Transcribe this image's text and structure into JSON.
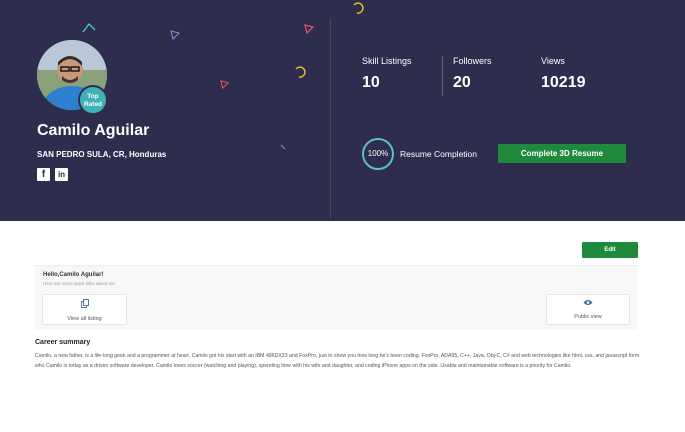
{
  "profile": {
    "name": "Camilo Aguilar",
    "location": "SAN PEDRO SULA, CR, Honduras",
    "badge": "Top Rated"
  },
  "stats": [
    {
      "label": "Skill Listings",
      "value": "10"
    },
    {
      "label": "Followers",
      "value": "20"
    },
    {
      "label": "Views",
      "value": "10219"
    }
  ],
  "resume": {
    "percent": "100%",
    "label": "Resume Completion",
    "button": "Complete 3D Resume"
  },
  "edit_button": "Edit",
  "hello": {
    "title": "Hello,Camilo Aguilar!",
    "subtitle": "Here are some quick links about me"
  },
  "quick_links": [
    {
      "label": "View all listing",
      "icon": "copy-icon"
    },
    {
      "label": "Public view",
      "icon": "eye-icon"
    }
  ],
  "career": {
    "title": "Career summary",
    "text": "Camilo, a new father, is a life-long geek and a programmer at heart. Camilo got his start with an IBM 486DX33 and FoxPro, just to show you how long he's been coding. FoxPro, ADA95, C++, Java, Obj-C, C# and web technologies like html, css, and javascript form who Camilo is today as a driven software developer. Camilo loves soccer (watching and playing), spending time with his wife and daughter, and coding iPhone apps on the side. Usable and maintainable software is a priority for Camilo."
  },
  "colors": {
    "banner": "#2f2d4e",
    "accent_green": "#1f8a3c",
    "ring": "#58c2c6"
  }
}
